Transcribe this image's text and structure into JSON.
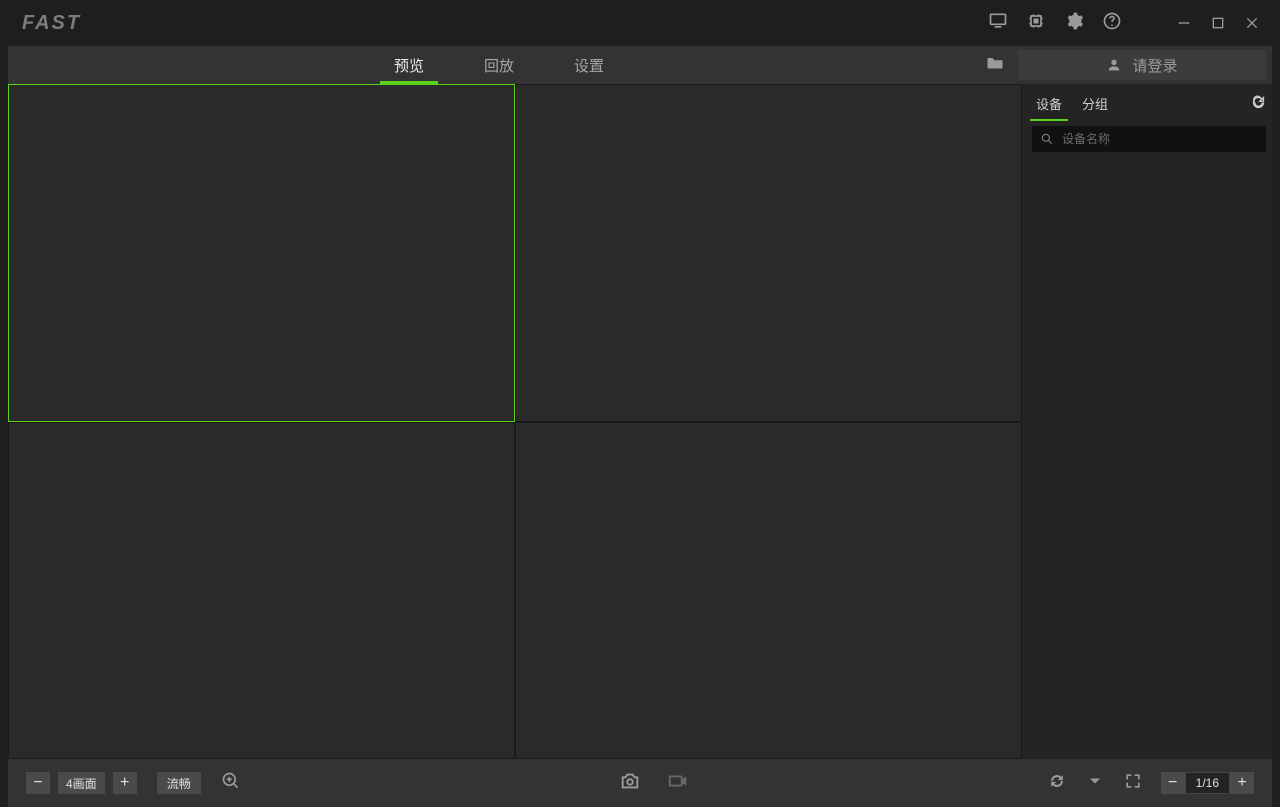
{
  "app": {
    "name": "FAST"
  },
  "window_controls": {
    "minimize": "minimize",
    "maximize": "maximize",
    "close": "close"
  },
  "toolbar": {
    "tabs": [
      {
        "label": "预览",
        "active": true
      },
      {
        "label": "回放",
        "active": false
      },
      {
        "label": "设置",
        "active": false
      }
    ],
    "login_label": "请登录"
  },
  "side": {
    "tabs": [
      {
        "label": "设备",
        "active": true
      },
      {
        "label": "分组",
        "active": false
      }
    ],
    "search_placeholder": "设备名称"
  },
  "bottom": {
    "layout_label": "4画面",
    "stream_label": "流畅",
    "page_display": "1/16",
    "minus": "−",
    "plus": "+"
  },
  "grid": {
    "layout": "2x2",
    "selected_index": 0
  },
  "icons": {
    "monitor": "monitor-icon",
    "cpu": "cpu-icon",
    "gear": "gear-icon",
    "help": "help-icon",
    "folder": "folder-icon",
    "user": "user-icon",
    "refresh": "refresh-icon",
    "search": "search-icon",
    "zoom_in": "zoom-in-icon",
    "camera": "camera-icon",
    "record": "record-icon",
    "cycle": "cycle-icon",
    "triangle_down": "expand-down-icon",
    "fullscreen": "fullscreen-icon"
  }
}
